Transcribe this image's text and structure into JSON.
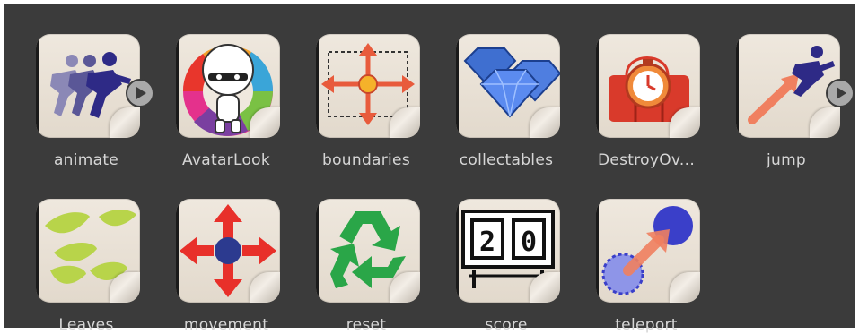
{
  "assets": [
    {
      "label": "animate",
      "icon": "running-figures-icon"
    },
    {
      "label": "AvatarLook",
      "icon": "avatar-color-wheel-icon"
    },
    {
      "label": "boundaries",
      "icon": "boundary-arrows-icon"
    },
    {
      "label": "collectables",
      "icon": "gems-icon"
    },
    {
      "label": "DestroyOv...",
      "icon": "bomb-timer-icon"
    },
    {
      "label": "jump",
      "icon": "jumping-figure-icon"
    },
    {
      "label": "Leaves",
      "icon": "leaves-icon"
    },
    {
      "label": "movement",
      "icon": "move-arrows-icon"
    },
    {
      "label": "reset",
      "icon": "recycle-icon"
    },
    {
      "label": "score",
      "icon": "scoreboard-icon"
    },
    {
      "label": "teleport",
      "icon": "teleport-icon"
    }
  ],
  "scoreboard_digits": [
    "2",
    "0"
  ],
  "colors": {
    "panel": "#3b3b3b",
    "label": "#d6d6d6",
    "tile": "#ebe4da"
  }
}
